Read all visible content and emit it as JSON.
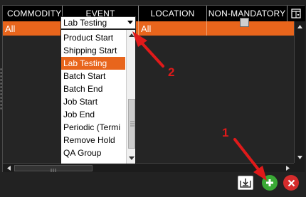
{
  "grid": {
    "columns": [
      "COMMODITY",
      "EVENT",
      "LOCATION",
      "NON-MANDATORY"
    ],
    "filter_row": {
      "commodity": "All",
      "event": "Lab Testing",
      "location": "All",
      "non_mandatory_checked": false
    }
  },
  "dropdown": {
    "items": [
      "Product Start",
      "Shipping Start",
      "Lab Testing",
      "Batch Start",
      "Batch End",
      "Job Start",
      "Job End",
      "Periodic (Termi",
      "Remove Hold",
      "QA Group"
    ],
    "selected": "Lab Testing"
  },
  "annotations": {
    "label_1": "1",
    "label_2": "2",
    "color": "#e01a1a"
  },
  "colors": {
    "accent": "#e8651c",
    "add": "#3aa935",
    "close": "#d62c2c"
  }
}
